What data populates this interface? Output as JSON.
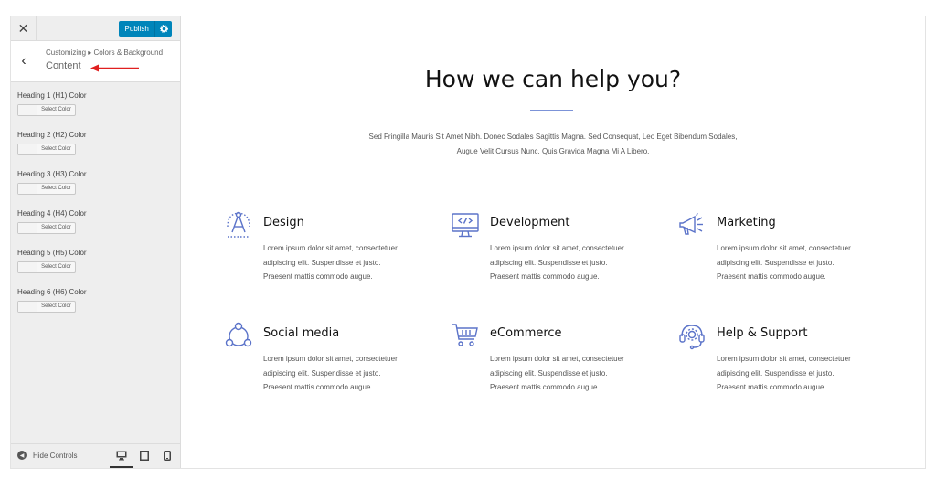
{
  "topbar": {
    "close": "✕",
    "publish_label": "Publish"
  },
  "section": {
    "breadcrumb": "Customizing ▸ Colors & Background",
    "title": "Content"
  },
  "controls": [
    {
      "label": "Heading 1 (H1) Color",
      "button": "Select Color"
    },
    {
      "label": "Heading 2 (H2) Color",
      "button": "Select Color"
    },
    {
      "label": "Heading 3 (H3) Color",
      "button": "Select Color"
    },
    {
      "label": "Heading 4 (H4) Color",
      "button": "Select Color"
    },
    {
      "label": "Heading 5 (H5) Color",
      "button": "Select Color"
    },
    {
      "label": "Heading 6 (H6) Color",
      "button": "Select Color"
    }
  ],
  "footer": {
    "hide_controls": "Hide Controls"
  },
  "preview": {
    "title": "How we can help you?",
    "subtitle_line1": "Sed Fringilla Mauris Sit Amet Nibh. Donec Sodales Sagittis Magna. Sed Consequat, Leo Eget Bibendum Sodales,",
    "subtitle_line2": "Augue Velit Cursus Nunc, Quis Gravida Magna Mi A Libero.",
    "features": [
      {
        "title": "Design",
        "icon": "design-compass-icon",
        "line1": "Lorem ipsum dolor sit amet, consectetuer",
        "line2": "adipiscing elit. Suspendisse et justo.",
        "line3": "Praesent mattis commodo augue."
      },
      {
        "title": "Development",
        "icon": "monitor-code-icon",
        "line1": "Lorem ipsum dolor sit amet, consectetuer",
        "line2": "adipiscing elit. Suspendisse et justo.",
        "line3": "Praesent mattis commodo augue."
      },
      {
        "title": "Marketing",
        "icon": "megaphone-icon",
        "line1": "Lorem ipsum dolor sit amet, consectetuer",
        "line2": "adipiscing elit. Suspendisse et justo.",
        "line3": "Praesent mattis commodo augue."
      },
      {
        "title": "Social media",
        "icon": "social-network-icon",
        "line1": "Lorem ipsum dolor sit amet, consectetuer",
        "line2": "adipiscing elit. Suspendisse et justo.",
        "line3": "Praesent mattis commodo augue."
      },
      {
        "title": "eCommerce",
        "icon": "shopping-cart-icon",
        "line1": "Lorem ipsum dolor sit amet, consectetuer",
        "line2": "adipiscing elit. Suspendisse et justo.",
        "line3": "Praesent mattis commodo augue."
      },
      {
        "title": "Help & Support",
        "icon": "support-headset-icon",
        "line1": "Lorem ipsum dolor sit amet, consectetuer",
        "line2": "adipiscing elit. Suspendisse et justo.",
        "line3": "Praesent mattis commodo augue."
      }
    ]
  },
  "colors": {
    "accent": "#0085ba",
    "icon": "#5b73c9",
    "arrow": "#e02020"
  }
}
